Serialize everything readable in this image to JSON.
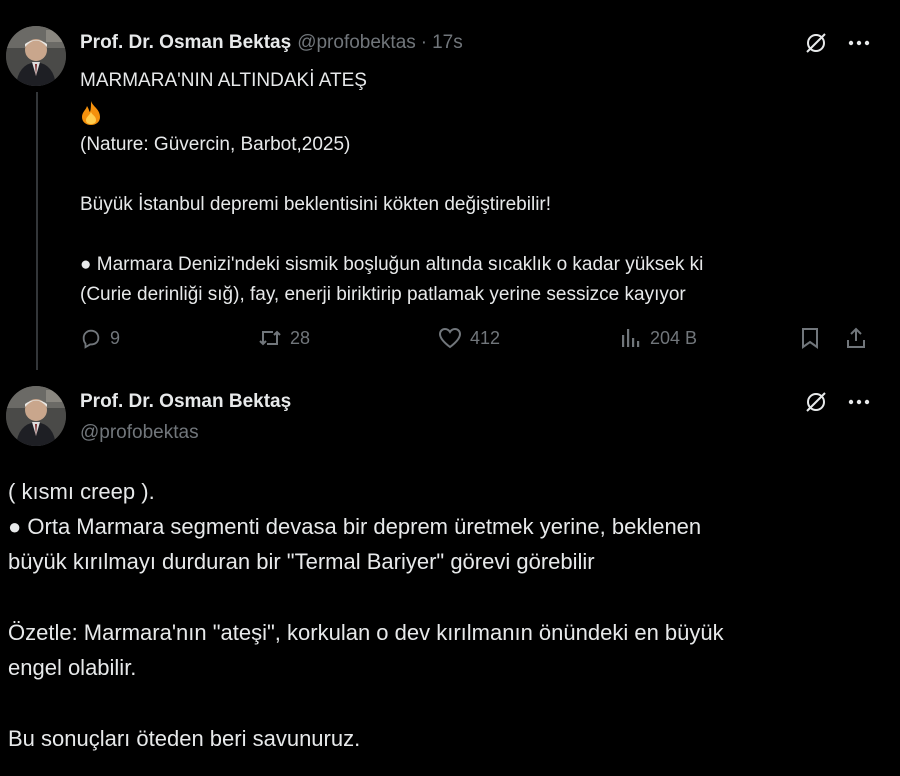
{
  "post1": {
    "author_name": "Prof. Dr. Osman Bektaş",
    "author_handle": "@profobektas",
    "separator": "·",
    "time": "17s",
    "text_lines": [
      "MARMARA'NIN ALTINDAKİ ATEŞ",
      "🔥",
      "(Nature: Güvercin, Barbot,2025)",
      "",
      "Büyük İstanbul depremi beklentisini kökten değiştirebilir!",
      "",
      "● Marmara Denizi'ndeki sismik boşluğun altında sıcaklık o kadar yüksek ki",
      "(Curie derinliği sığ), fay, enerji biriktirip patlamak yerine sessizce kayıyor"
    ],
    "stats": {
      "replies": "9",
      "reposts": "28",
      "likes": "412",
      "views": "204 B"
    }
  },
  "post2": {
    "author_name": "Prof. Dr. Osman Bektaş",
    "author_handle": "@profobektas",
    "text_lines": [
      "( kısmı creep ).",
      "● Orta Marmara segmenti devasa bir deprem üretmek yerine, beklenen",
      "büyük kırılmayı durduran bir \"Termal Bariyer\" görevi görebilir",
      "",
      "Özetle: Marmara'nın \"ateşi\", korkulan o dev kırılmanın önündeki en büyük",
      "engel olabilir.",
      "",
      "Bu sonuçları öteden beri savunuruz."
    ]
  },
  "icons": {
    "reply": "reply-icon",
    "repost": "repost-icon",
    "like": "heart-icon",
    "views": "views-icon",
    "bookmark": "bookmark-icon",
    "share": "share-icon",
    "grok": "grok-icon",
    "more": "more-icon"
  },
  "colors": {
    "background": "#000000",
    "text": "#e7e9ea",
    "muted": "#71767b",
    "thread_line": "#333639"
  }
}
